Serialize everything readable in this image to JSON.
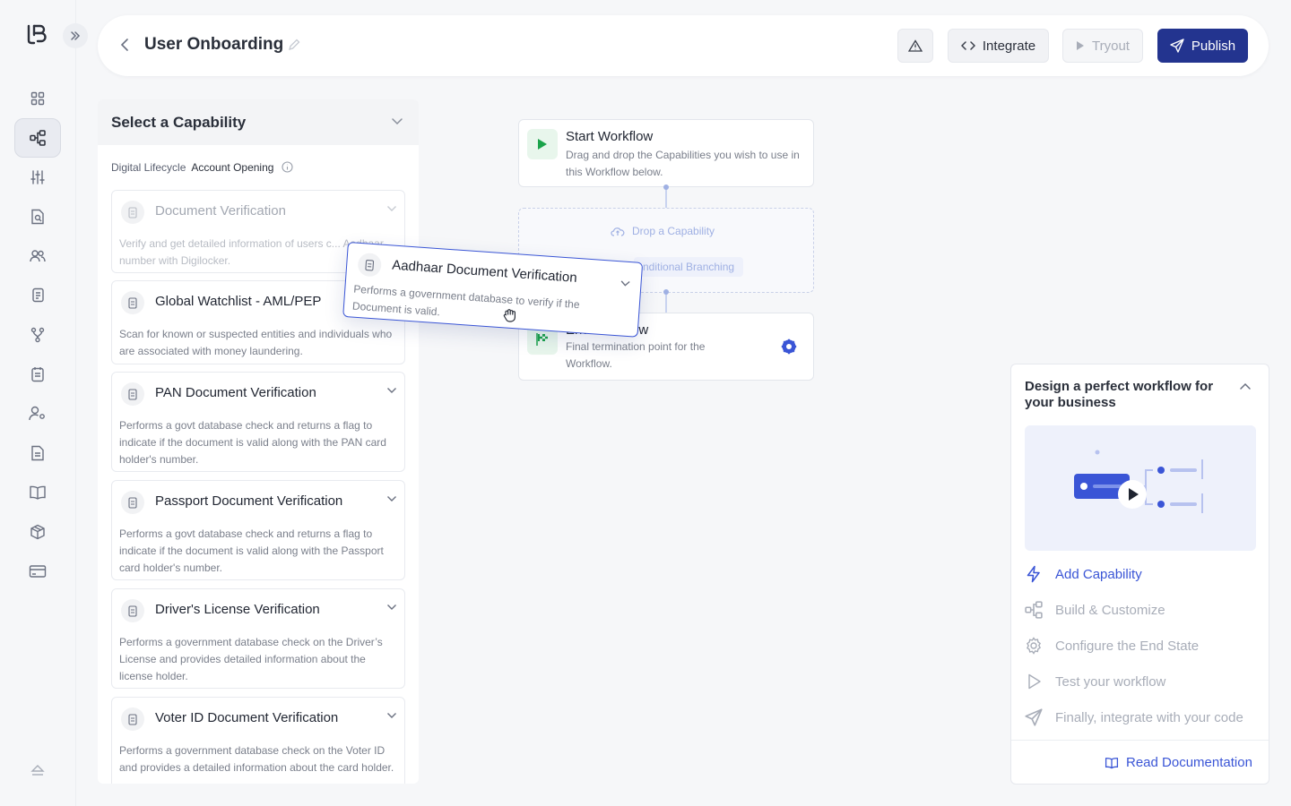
{
  "header": {
    "title": "User Onboarding",
    "integrate_label": "Integrate",
    "tryout_label": "Tryout",
    "publish_label": "Publish"
  },
  "panel": {
    "title": "Select a Capability",
    "breadcrumb_parent": "Digital Lifecycle",
    "breadcrumb_current": "Account Opening",
    "cards": [
      {
        "title": "Document Verification",
        "desc": "Verify and get detailed information of users c... Aadhaar number with Digilocker."
      },
      {
        "title": "Global Watchlist - AML/PEP",
        "desc": "Scan for known or suspected entities and individuals who are associated with money laundering."
      },
      {
        "title": "PAN Document Verification",
        "desc": "Performs a govt database check and returns a flag to indicate if the document is valid along with the PAN card holder's number."
      },
      {
        "title": "Passport Document Verification",
        "desc": "Performs a govt database check and returns a flag to indicate if the document is valid along with the Passport card holder's number."
      },
      {
        "title": "Driver's License Verification",
        "desc": "Performs a government database check on the Driver’s License and provides detailed information about the license holder."
      },
      {
        "title": "Voter ID Document Verification",
        "desc": "Performs a government database check on the Voter ID and provides a detailed information about the card holder."
      }
    ]
  },
  "canvas": {
    "start_title": "Start Workflow",
    "start_desc": "Drag and drop the Capabilities you wish to use in this Workflow below.",
    "drop_label": "Drop a Capability",
    "branching_label": "nditional Branching",
    "end_title": "End Workflow",
    "end_desc": "Final termination point for the Workflow."
  },
  "dragging": {
    "title": "Aadhaar Document Verification",
    "desc": "Performs a government database to verify if the Document is valid."
  },
  "help": {
    "title": "Design a perfect workflow for your business",
    "steps": [
      {
        "label": "Add Capability",
        "icon": "lightning-icon"
      },
      {
        "label": "Build & Customize",
        "icon": "flow-icon"
      },
      {
        "label": "Configure the End State",
        "icon": "gear-icon"
      },
      {
        "label": "Test your workflow",
        "icon": "play-icon"
      },
      {
        "label": "Finally, integrate with your code",
        "icon": "send-icon"
      }
    ],
    "docs_label": "Read Documentation"
  },
  "colors": {
    "primary": "#23348f",
    "accent": "#3a55d6",
    "success": "#1aa34a"
  }
}
